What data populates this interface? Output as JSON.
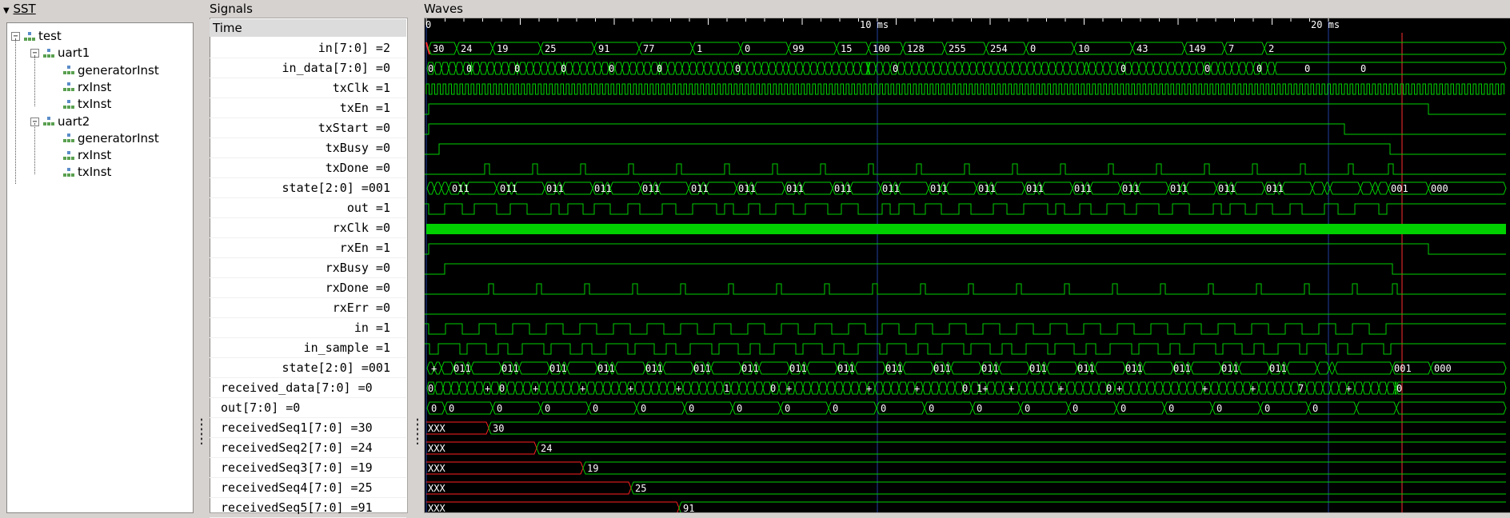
{
  "sst": {
    "title": "SST",
    "tree": [
      {
        "label": "test",
        "level": 0,
        "expander": "−"
      },
      {
        "label": "uart1",
        "level": 1,
        "expander": "−"
      },
      {
        "label": "generatorInst",
        "level": 2,
        "expander": ""
      },
      {
        "label": "rxInst",
        "level": 2,
        "expander": ""
      },
      {
        "label": "txInst",
        "level": 2,
        "expander": ""
      },
      {
        "label": "uart2",
        "level": 1,
        "expander": "−"
      },
      {
        "label": "generatorInst",
        "level": 2,
        "expander": ""
      },
      {
        "label": "rxInst",
        "level": 2,
        "expander": ""
      },
      {
        "label": "txInst",
        "level": 2,
        "expander": ""
      }
    ]
  },
  "signals": {
    "title": "Signals",
    "header": "Time",
    "rows": [
      "in[7:0] =2",
      "in_data[7:0] =0",
      "txClk =1",
      "txEn =1",
      "txStart =0",
      "txBusy =0",
      "txDone =0",
      "state[2:0] =001",
      "out =1",
      "rxClk =0",
      "rxEn =1",
      "rxBusy =0",
      "rxDone =0",
      "rxErr =0",
      "in =1",
      "in_sample =1",
      "state[2:0] =001",
      "received_data[7:0] =0",
      "out[7:0] =0",
      "receivedSeq1[7:0] =30",
      "receivedSeq2[7:0] =24",
      "receivedSeq3[7:0] =19",
      "receivedSeq4[7:0] =25",
      "receivedSeq5[7:0] =91"
    ]
  },
  "waves": {
    "title": "Waves",
    "time_markers": [
      {
        "label": "0"
      },
      {
        "label": "10 ms"
      },
      {
        "label": "20 ms"
      }
    ],
    "bus_in": [
      "30",
      "24",
      "19",
      "25",
      "91",
      "77",
      "1",
      "0",
      "99",
      "15",
      "100",
      "128",
      "255",
      "254",
      "0",
      "10",
      "43",
      "149",
      "7",
      "2"
    ],
    "bus_in_data_labels": [
      "0",
      "0",
      "0",
      "0",
      "0",
      "0",
      "0",
      "0",
      "0",
      "0",
      "0",
      "0",
      "0"
    ],
    "bus_state_tx": [
      "011",
      "011",
      "011",
      "011",
      "011",
      "011",
      "011",
      "011",
      "011",
      "011",
      "011",
      "011",
      "011",
      "011",
      "011",
      "011",
      "011",
      "011",
      "001",
      "000"
    ],
    "bus_state_rx": [
      "+",
      "011",
      "011",
      "011",
      "011",
      "011",
      "011",
      "011",
      "011",
      "011",
      "011",
      "011",
      "011",
      "011",
      "011",
      "011",
      "011",
      "011",
      "011",
      "001",
      "000"
    ],
    "bus_received_data": [
      "0",
      "+",
      "0",
      "+",
      "+",
      "+",
      "+",
      "1",
      "0",
      "+",
      "+",
      "+",
      "0",
      "1+",
      "+",
      "+",
      "0",
      "+",
      "+",
      "+",
      "7",
      "+",
      "0"
    ],
    "bus_out": [
      "0",
      "0",
      "0",
      "0",
      "0",
      "0",
      "0",
      "0",
      "0",
      "0",
      "0",
      "0",
      "0",
      "0",
      "0",
      "0",
      "0",
      "0",
      "0",
      "0"
    ],
    "received_seq": [
      {
        "xxx": "XXX",
        "value": "30"
      },
      {
        "xxx": "XXX",
        "value": "24"
      },
      {
        "xxx": "XXX",
        "value": "19"
      },
      {
        "xxx": "XXX",
        "value": "25"
      },
      {
        "xxx": "XXX",
        "value": "91"
      }
    ],
    "colors": {
      "wave": "#00d000",
      "background": "#000000",
      "marker": "#ff3030",
      "grid": "#2040a0",
      "xxx": "#ff2020"
    }
  }
}
